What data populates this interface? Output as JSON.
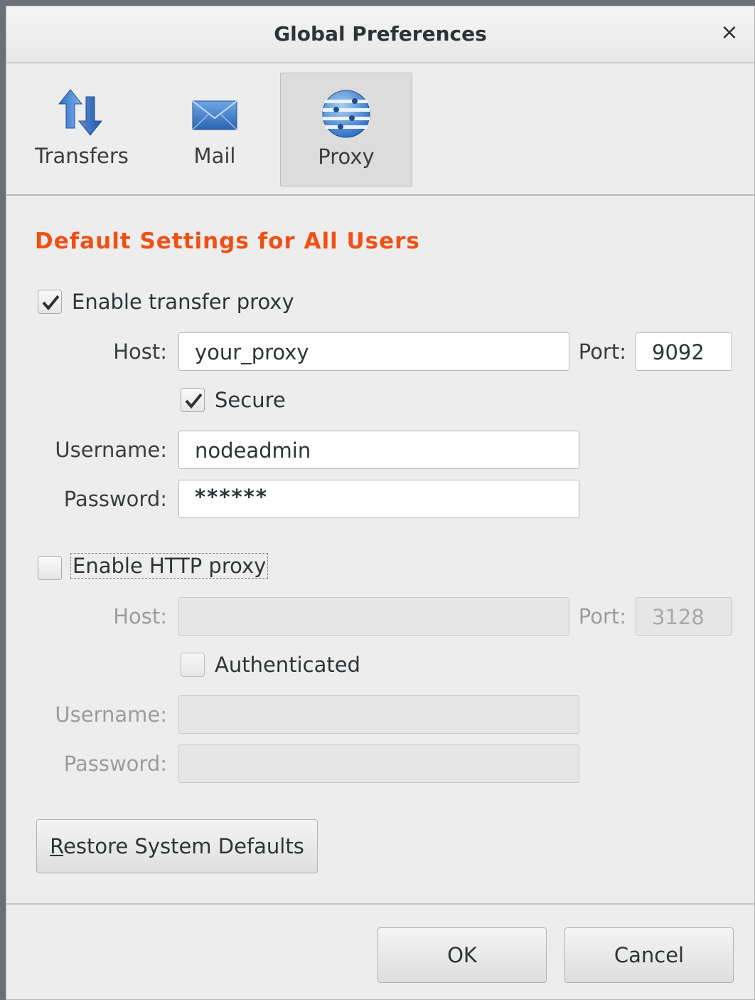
{
  "window": {
    "title": "Global Preferences",
    "close_glyph": "×"
  },
  "tabs": [
    {
      "label": "Transfers",
      "icon": "transfers-icon",
      "active": false
    },
    {
      "label": "Mail",
      "icon": "mail-icon",
      "active": false
    },
    {
      "label": "Proxy",
      "icon": "proxy-icon",
      "active": true
    }
  ],
  "section": {
    "heading": "Default Settings for All Users",
    "heading_color": "#f05014"
  },
  "transfer_proxy": {
    "enable_label": "Enable transfer proxy",
    "enabled": true,
    "host_label": "Host:",
    "host_value": "your_proxy",
    "port_label": "Port:",
    "port_value": "9092",
    "secure_label": "Secure",
    "secure": true,
    "username_label": "Username:",
    "username_value": "nodeadmin",
    "password_label": "Password:",
    "password_value": "******"
  },
  "http_proxy": {
    "enable_label": "Enable HTTP proxy",
    "enabled": false,
    "host_label": "Host:",
    "host_value": "",
    "port_label": "Port:",
    "port_value": "3128",
    "auth_label": "Authenticated",
    "authenticated": false,
    "username_label": "Username:",
    "username_value": "",
    "password_label": "Password:",
    "password_value": ""
  },
  "buttons": {
    "restore_mnemonic": "R",
    "restore_rest": "estore System Defaults",
    "ok": "OK",
    "cancel": "Cancel"
  }
}
